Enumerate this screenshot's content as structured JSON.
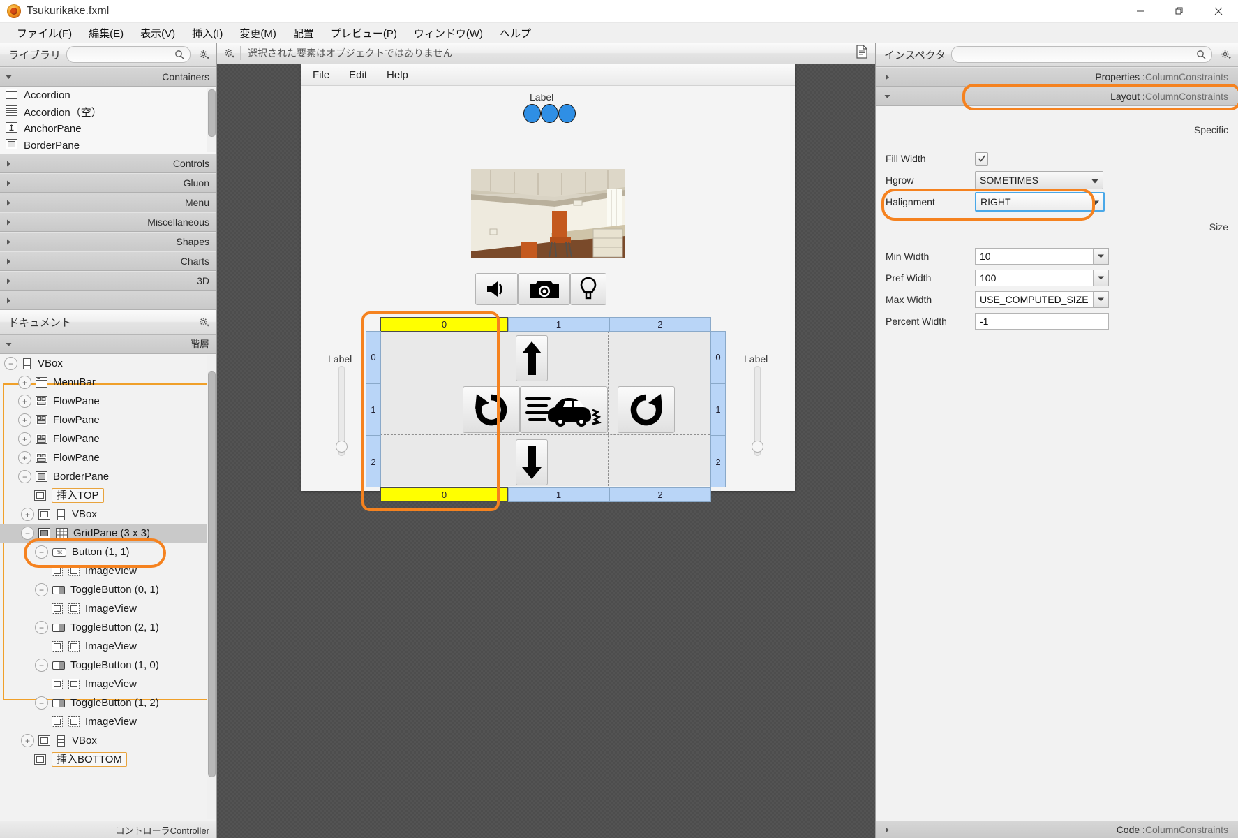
{
  "window": {
    "title": "Tsukurikake.fxml",
    "logo_icon": "scenebuilder-logo-icon",
    "controls": [
      {
        "name": "minimize-button",
        "icon": "minimize-icon"
      },
      {
        "name": "restore-button",
        "icon": "restore-icon"
      },
      {
        "name": "close-button",
        "icon": "close-icon"
      }
    ]
  },
  "menubar": {
    "items": [
      "ファイル(F)",
      "編集(E)",
      "表示(V)",
      "挿入(I)",
      "変更(M)",
      "配置",
      "プレビュー(P)",
      "ウィンドウ(W)",
      "ヘルプ"
    ]
  },
  "library": {
    "title": "ライブラリ",
    "search_placeholder": "",
    "search_value": "",
    "search_icon": "search-icon",
    "gear_icon": "gear-icon",
    "sections": [
      {
        "label": "Containers",
        "expanded": true
      },
      {
        "label": "Controls",
        "expanded": false
      },
      {
        "label": "Gluon",
        "expanded": false
      },
      {
        "label": "Menu",
        "expanded": false
      },
      {
        "label": "Miscellaneous",
        "expanded": false
      },
      {
        "label": "Shapes",
        "expanded": false
      },
      {
        "label": "Charts",
        "expanded": false
      },
      {
        "label": "3D",
        "expanded": false
      },
      {
        "label": "",
        "expanded": false
      }
    ],
    "items": [
      {
        "label": "Accordion",
        "icon": "accordion-icon"
      },
      {
        "label": "Accordion（空）",
        "icon": "accordion-empty-icon"
      },
      {
        "label": "AnchorPane",
        "icon": "anchorpane-icon"
      },
      {
        "label": "BorderPane",
        "icon": "borderpane-icon"
      }
    ]
  },
  "document": {
    "title": "ドキュメント",
    "gear_icon": "gear-icon",
    "section_label": "階層",
    "status": "コントローラController",
    "tree": [
      {
        "label": "VBox",
        "icon": "vbox-icon",
        "indent": 0,
        "expander": "minus"
      },
      {
        "label": "MenuBar",
        "icon": "menubar-icon",
        "indent": 1,
        "expander": "plus"
      },
      {
        "label": "FlowPane",
        "icon": "flowpane-icon",
        "indent": 1,
        "expander": "plus"
      },
      {
        "label": "FlowPane",
        "icon": "flowpane-icon",
        "indent": 1,
        "expander": "plus"
      },
      {
        "label": "FlowPane",
        "icon": "flowpane-icon",
        "indent": 1,
        "expander": "plus"
      },
      {
        "label": "FlowPane",
        "icon": "flowpane-icon",
        "indent": 1,
        "expander": "plus"
      },
      {
        "label": "BorderPane",
        "icon": "borderpane-icon",
        "indent": 1,
        "expander": "minus"
      },
      {
        "label": "挿入TOP",
        "icon": "borderpane-slot-icon",
        "indent": 2,
        "expander": "none",
        "boxed": true
      },
      {
        "label": "VBox",
        "icon": "borderpane-slot-icon",
        "icon2": "vbox-icon",
        "indent": 2,
        "expander": "plus"
      },
      {
        "label": "GridPane (3 x 3)",
        "icon": "borderpane-slot-icon",
        "icon2": "gridpane-icon",
        "indent": 2,
        "expander": "minus",
        "selected": true
      },
      {
        "label": "Button (1, 1)",
        "icon": "button-ok-icon",
        "indent": 3,
        "expander": "minus"
      },
      {
        "label": "ImageView",
        "icon": "imageview-icon",
        "icon2": "imageview-icon",
        "indent": 4,
        "expander": "none"
      },
      {
        "label": "ToggleButton (0, 1)",
        "icon": "togglebutton-icon",
        "indent": 3,
        "expander": "minus"
      },
      {
        "label": "ImageView",
        "icon": "imageview-icon",
        "icon2": "imageview-icon",
        "indent": 4,
        "expander": "none"
      },
      {
        "label": "ToggleButton (2, 1)",
        "icon": "togglebutton-icon",
        "indent": 3,
        "expander": "minus"
      },
      {
        "label": "ImageView",
        "icon": "imageview-icon",
        "icon2": "imageview-icon",
        "indent": 4,
        "expander": "none"
      },
      {
        "label": "ToggleButton (1, 0)",
        "icon": "togglebutton-icon",
        "indent": 3,
        "expander": "minus"
      },
      {
        "label": "ImageView",
        "icon": "imageview-icon",
        "icon2": "imageview-icon",
        "indent": 4,
        "expander": "none"
      },
      {
        "label": "ToggleButton (1, 2)",
        "icon": "togglebutton-icon",
        "indent": 3,
        "expander": "minus"
      },
      {
        "label": "ImageView",
        "icon": "imageview-icon",
        "icon2": "imageview-icon",
        "indent": 4,
        "expander": "none"
      },
      {
        "label": "VBox",
        "icon": "borderpane-slot-icon",
        "icon2": "vbox-icon",
        "indent": 2,
        "expander": "plus"
      },
      {
        "label": "挿入BOTTOM",
        "icon": "borderpane-slot-icon",
        "indent": 2,
        "expander": "none",
        "boxed": true
      }
    ]
  },
  "content_panel": {
    "gear_icon": "gear-icon",
    "message": "選択された要素はオブジェクトではありません",
    "doc_icon": "document-preview-icon"
  },
  "stage_preview": {
    "menus": [
      "File",
      "Edit",
      "Help"
    ],
    "top_label": "Label",
    "dots_count": 3,
    "dot_color": "#2f8fe5",
    "photo_alt": "office-room-photo",
    "left_label": "Label",
    "right_label": "Label",
    "toolbar_buttons": [
      {
        "name": "speaker-button",
        "icon": "speaker-icon"
      },
      {
        "name": "camera-button",
        "icon": "camera-icon"
      },
      {
        "name": "lightbulb-button",
        "icon": "lightbulb-icon"
      }
    ],
    "grid": {
      "rows": 3,
      "cols": 3,
      "column_headers_top": [
        "0",
        "1",
        "2"
      ],
      "column_headers_bottom": [
        "0",
        "1",
        "2"
      ],
      "row_headers_left": [
        "0",
        "1",
        "2"
      ],
      "row_headers_right": [
        "0",
        "1",
        "2"
      ],
      "selected_column": "0",
      "selected_header_color": "#ffff00",
      "header_color": "#b9d5f7",
      "cells": [
        {
          "row": 0,
          "col": 1,
          "name": "up-arrow-button",
          "icon": "arrow-up-icon"
        },
        {
          "row": 1,
          "col": 0,
          "name": "rotate-left-button",
          "icon": "rotate-ccw-icon"
        },
        {
          "row": 1,
          "col": 1,
          "name": "car-button",
          "icon": "car-icon"
        },
        {
          "row": 1,
          "col": 2,
          "name": "rotate-right-button",
          "icon": "rotate-cw-icon"
        },
        {
          "row": 2,
          "col": 1,
          "name": "down-arrow-button",
          "icon": "arrow-down-icon"
        }
      ]
    }
  },
  "inspector": {
    "title": "インスペクタ",
    "search_placeholder": "",
    "search_value": "",
    "search_icon": "search-icon",
    "gear_icon": "gear-icon",
    "sections": [
      {
        "label": "Properties : ColumnConstraints",
        "prefix": "Properties : ",
        "type": "ColumnConstraints",
        "expanded": false
      },
      {
        "label": "Layout : ColumnConstraints",
        "prefix": "Layout : ",
        "type": "ColumnConstraints",
        "expanded": true,
        "highlighted": true
      }
    ],
    "groups": [
      {
        "title": "Specific",
        "fields": [
          {
            "label": "Fill Width",
            "type": "checkbox",
            "value": "checked"
          },
          {
            "label": "Hgrow",
            "type": "combo",
            "value": "SOMETIMES"
          },
          {
            "label": "Halignment",
            "type": "combo",
            "value": "RIGHT",
            "focused": true,
            "highlighted": true
          }
        ]
      },
      {
        "title": "Size",
        "fields": [
          {
            "label": "Min Width",
            "type": "spinner",
            "value": "10"
          },
          {
            "label": "Pref Width",
            "type": "spinner",
            "value": "100"
          },
          {
            "label": "Max Width",
            "type": "spinner",
            "value": "USE_COMPUTED_SIZE"
          },
          {
            "label": "Percent Width",
            "type": "text",
            "value": "-1"
          }
        ]
      }
    ],
    "status": "Code : ColumnConstraints",
    "status_prefix": "Code : ",
    "status_type": "ColumnConstraints"
  },
  "colors": {
    "accent_orange": "#f5821f",
    "selection_blue": "#4aa8e8",
    "grid_header_blue": "#b9d5f7",
    "grid_header_yellow": "#ffff00",
    "tree_highlight": "#f0a02a"
  }
}
